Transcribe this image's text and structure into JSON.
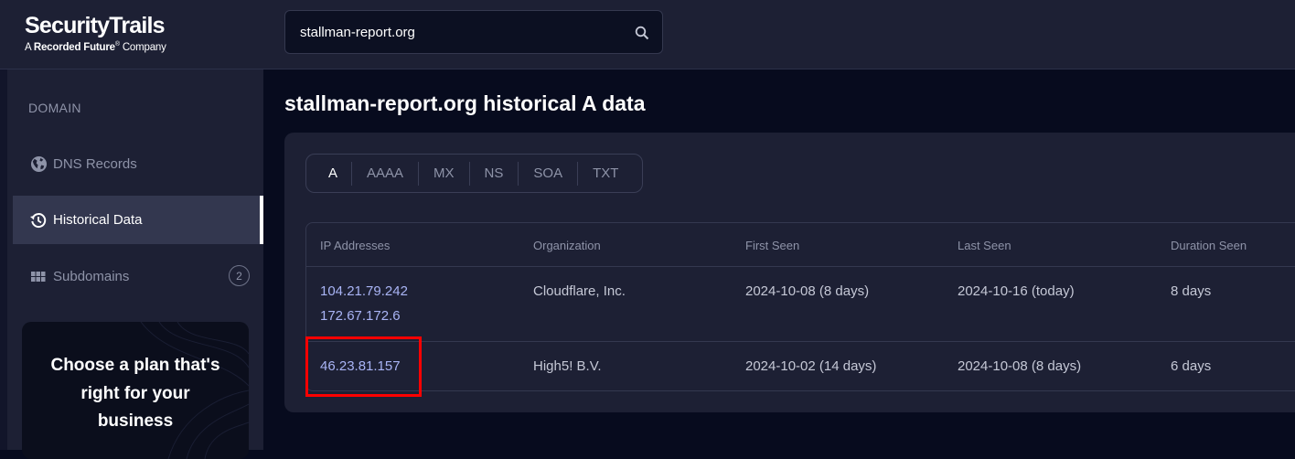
{
  "header": {
    "logo_main": "SecurityTrails",
    "logo_sub_prefix": "A ",
    "logo_sub_brand": "Recorded Future",
    "logo_sub_reg": "®",
    "logo_sub_suffix": " Company",
    "search_value": "stallman-report.org",
    "search_icon": "search-icon"
  },
  "sidebar": {
    "section_label": "DOMAIN",
    "items": [
      {
        "label": "DNS Records",
        "icon": "globe-icon",
        "active": false
      },
      {
        "label": "Historical Data",
        "icon": "history-icon",
        "active": true
      },
      {
        "label": "Subdomains",
        "icon": "grid-icon",
        "active": false,
        "badge": "2"
      }
    ],
    "promo_lines": [
      "Choose a plan that's",
      "right for your",
      "business"
    ]
  },
  "main": {
    "title": "stallman-report.org historical A data",
    "tabs": [
      {
        "label": "A",
        "active": true
      },
      {
        "label": "AAAA",
        "active": false
      },
      {
        "label": "MX",
        "active": false
      },
      {
        "label": "NS",
        "active": false
      },
      {
        "label": "SOA",
        "active": false
      },
      {
        "label": "TXT",
        "active": false
      }
    ],
    "table": {
      "columns": [
        "IP Addresses",
        "Organization",
        "First Seen",
        "Last Seen",
        "Duration Seen"
      ],
      "rows": [
        {
          "ips": [
            "104.21.79.242",
            "172.67.172.6"
          ],
          "organization": "Cloudflare, Inc.",
          "first_seen": "2024-10-08 (8 days)",
          "last_seen": "2024-10-16 (today)",
          "duration": "8 days"
        },
        {
          "ips": [
            "46.23.81.157"
          ],
          "organization": "High5! B.V.",
          "first_seen": "2024-10-02 (14 days)",
          "last_seen": "2024-10-08 (8 days)",
          "duration": "6 days"
        }
      ]
    }
  },
  "colors": {
    "accent_link": "#a9b4f5",
    "highlight": "#ff0000",
    "background": "#070b1e",
    "panel": "#1d2034"
  }
}
